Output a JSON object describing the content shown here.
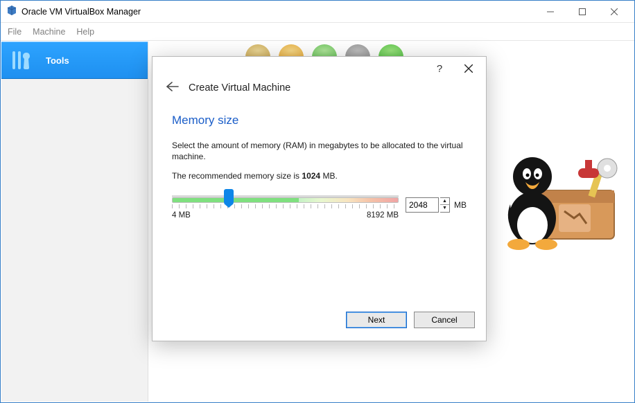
{
  "window": {
    "title": "Oracle VM VirtualBox Manager",
    "menu": {
      "file": "File",
      "machine": "Machine",
      "help": "Help"
    }
  },
  "sidebar": {
    "tools_label": "Tools"
  },
  "dialog": {
    "wizard_title": "Create Virtual Machine",
    "heading": "Memory size",
    "desc": "Select the amount of memory (RAM) in megabytes to be allocated to the virtual machine.",
    "recommend_prefix": "The recommended memory size is ",
    "recommend_value": "1024",
    "recommend_suffix": " MB.",
    "slider_min_label": "4 MB",
    "slider_max_label": "8192 MB",
    "value": "2048",
    "unit": "MB",
    "buttons": {
      "next": "Next",
      "cancel": "Cancel"
    }
  },
  "slider": {
    "min": 4,
    "max": 8192,
    "value": 2048,
    "thumb_percent": 25
  }
}
